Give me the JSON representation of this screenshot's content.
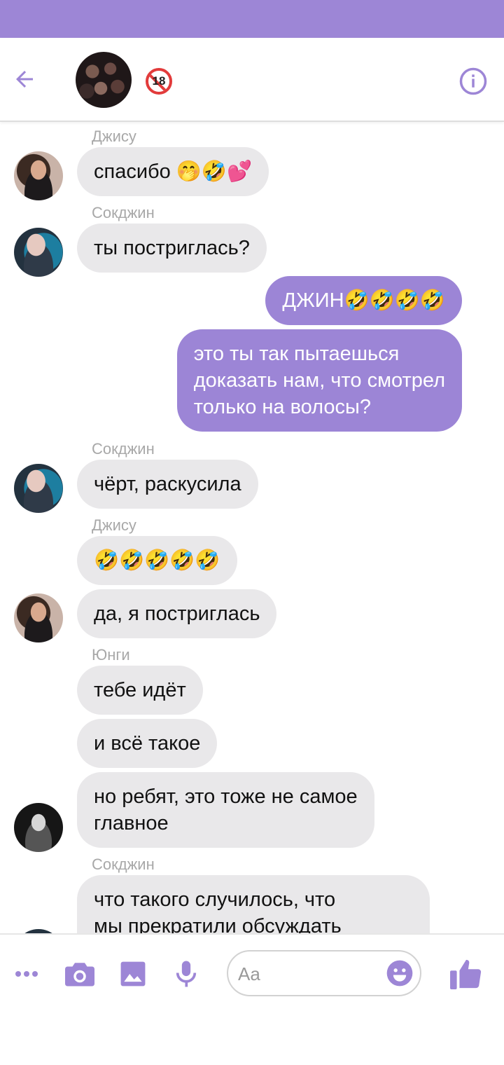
{
  "theme": {
    "accent": "#9d86d6",
    "incoming_bubble": "#e9e8ea",
    "outgoing_bubble": "#9c85d6"
  },
  "header": {
    "back_icon": "arrow-left-icon",
    "age_badge": "18",
    "info_icon": "info-circle-icon"
  },
  "messages": [
    {
      "sender": "Джису",
      "text": "спасибо 🤭🤣💕"
    },
    {
      "sender": "Сокджин",
      "text": "ты постриглась?"
    },
    {
      "text": "ДЖИН🤣🤣🤣🤣"
    },
    {
      "text": "это ты так пытаешься\nдоказать нам, что смотрел\nтолько на волосы?"
    },
    {
      "sender": "Сокджин",
      "text": "чёрт, раскусила"
    },
    {
      "sender": "Джису",
      "text": "🤣🤣🤣🤣🤣"
    },
    {
      "text": "да, я постриглась"
    },
    {
      "sender": "Юнги",
      "text": "тебе идёт"
    },
    {
      "text": "и всё такое"
    },
    {
      "text": "но ребят, это тоже не самое\nглавное"
    },
    {
      "sender": "Сокджин",
      "text": "что такого случилось, что\nмы прекратили обсуждать"
    }
  ],
  "composer": {
    "placeholder": "Aa",
    "icons": [
      "more-icon",
      "camera-icon",
      "image-icon",
      "microphone-icon",
      "emoji-icon",
      "like-icon"
    ]
  }
}
